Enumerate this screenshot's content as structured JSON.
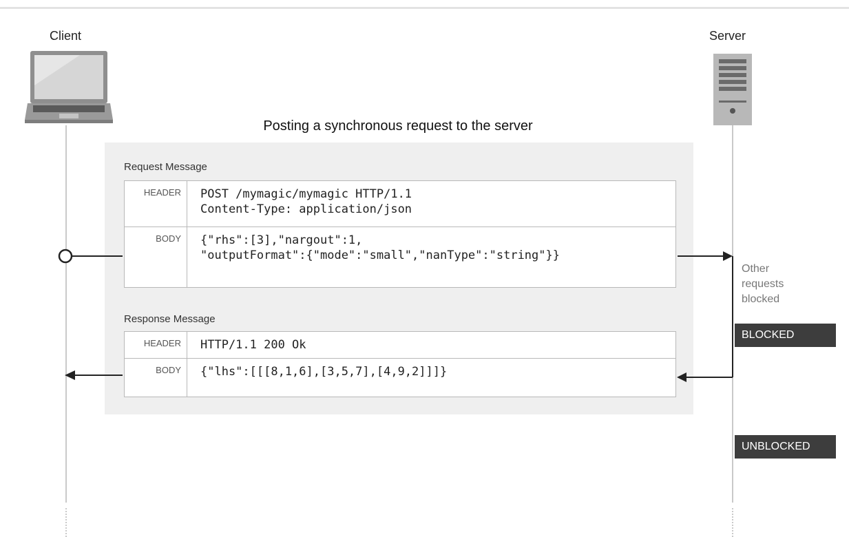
{
  "title": "Posting a synchronous request to the server",
  "actors": {
    "client": "Client",
    "server": "Server"
  },
  "request": {
    "label": "Request Message",
    "header_label": "HEADER",
    "header_lines": "POST /mymagic/mymagic HTTP/1.1\nContent-Type: application/json",
    "body_label": "BODY",
    "body_lines": "{\"rhs\":[3],\"nargout\":1,\n\"outputFormat\":{\"mode\":\"small\",\"nanType\":\"string\"}}"
  },
  "response": {
    "label": "Response Message",
    "header_label": "HEADER",
    "header_lines": "HTTP/1.1 200 Ok",
    "body_label": "BODY",
    "body_lines": "{\"lhs\":[[[8,1,6],[3,5,7],[4,9,2]]]}"
  },
  "server_note": "Other\nrequests\nblocked",
  "statuses": {
    "blocked": "BLOCKED",
    "unblocked": "UNBLOCKED"
  },
  "icons": {
    "client": "laptop-icon",
    "server": "server-icon"
  }
}
